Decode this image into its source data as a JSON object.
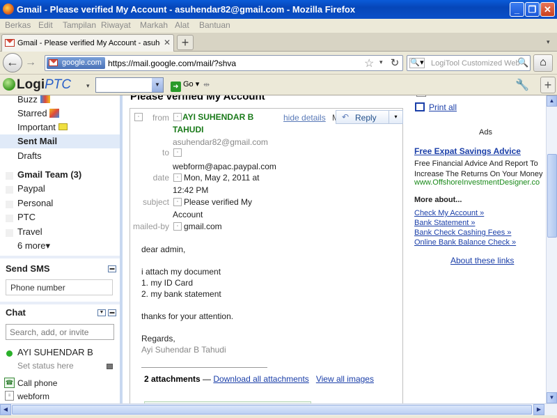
{
  "window": {
    "title": "Gmail - Please verified My Account - asuhendar82@gmail.com - Mozilla Firefox"
  },
  "menu": [
    "Berkas",
    "Edit",
    "Tampilan",
    "Riwayat",
    "Markah",
    "Alat",
    "Bantuan"
  ],
  "tab": {
    "label": "Gmail - Please verified My Account - asuhen..."
  },
  "nav": {
    "identity": "google.com",
    "url": "https://mail.google.com/mail/?shva",
    "search_placeholder": "LogiTool Customized Web Search"
  },
  "toolbar": {
    "logo_logi": "Logi",
    "logo_ptc": "PTC",
    "go": "Go"
  },
  "sidebar": {
    "items": [
      "Buzz",
      "Starred",
      "Important",
      "Sent Mail",
      "Drafts"
    ],
    "labels": [
      "Gmail Team (3)",
      "Paypal",
      "Personal",
      "PTC",
      "Travel"
    ],
    "more": "6 more▾",
    "sms_title": "Send SMS",
    "sms_placeholder": "Phone number",
    "chat_title": "Chat",
    "chat_placeholder": "Search, add, or invite",
    "user": "AYI SUHENDAR B",
    "status": "Set status here",
    "call": "Call phone",
    "webform": "webform"
  },
  "message": {
    "subject_title": "Please verified My Account",
    "hide_details": "hide details",
    "hide_suffix": "M",
    "reply": "Reply",
    "header": {
      "from_label": "from",
      "from_name_1": "AYI SUHENDAR B",
      "from_name_2": "TAHUDI",
      "from_email": "asuhendar82@gmail.com",
      "to_label": "to",
      "to": "webform@apac.paypal.com",
      "date_label": "date",
      "date_1": "Mon, May 2, 2011 at",
      "date_2": "12:42 PM",
      "subject_label": "subject",
      "subject_1": "Please verified My",
      "subject_2": "Account",
      "mailedby_label": "mailed-by",
      "mailedby": "gmail.com"
    },
    "body": [
      "dear admin,",
      "",
      "i attach my document",
      "1. my ID Card",
      "2. my bank statement",
      "",
      "thanks for your attention.",
      "",
      "Regards,"
    ],
    "signature": "Ayi Suhendar B Tahudi",
    "attachments_count": "2 attachments",
    "attachments_dash": "—",
    "download_all": "Download all attachments",
    "view_all": "View all images"
  },
  "ads": {
    "print_all": "Print all",
    "heading": "Ads",
    "ad_title": "Free Expat Savings Advice",
    "ad_text": "Free Financial Advice And Report To Increase The Returns On Your Money",
    "ad_url": "www.OffshoreInvestmentDesigner.co",
    "more_about": "More about...",
    "links": [
      "Check My Account »",
      "Bank Statement »",
      "Bank Check Cashing Fees »",
      "Online Bank Balance Check »"
    ],
    "about": "About these links"
  }
}
